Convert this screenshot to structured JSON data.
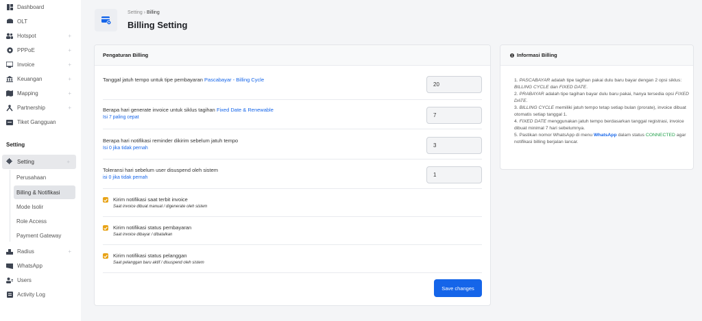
{
  "sidebar": {
    "items": [
      {
        "label": "Dashboard",
        "icon": "dashboard-icon",
        "plus": false
      },
      {
        "label": "OLT",
        "icon": "olt-icon",
        "plus": false
      },
      {
        "label": "Hotspot",
        "icon": "hotspot-icon",
        "plus": true
      },
      {
        "label": "PPPoE",
        "icon": "pppoe-icon",
        "plus": true
      },
      {
        "label": "Invoice",
        "icon": "invoice-icon",
        "plus": true
      },
      {
        "label": "Keuangan",
        "icon": "bank-icon",
        "plus": true
      },
      {
        "label": "Mapping",
        "icon": "map-icon",
        "plus": true
      },
      {
        "label": "Partnership",
        "icon": "partnership-icon",
        "plus": true
      },
      {
        "label": "Tiket Gangguan",
        "icon": "ticket-icon",
        "plus": false
      }
    ],
    "section_title": "Setting",
    "setting": {
      "label": "Setting",
      "icon": "gear-icon"
    },
    "sub_items": [
      "Perusahaan",
      "Billing & Notifikasi",
      "Mode Isolir",
      "Role Access",
      "Payment Gateway"
    ],
    "bottom_items": [
      {
        "label": "Radius",
        "icon": "radius-icon",
        "plus": true
      },
      {
        "label": "WhatsApp",
        "icon": "whatsapp-icon",
        "plus": false
      },
      {
        "label": "Users",
        "icon": "users-icon",
        "plus": false
      },
      {
        "label": "Activity Log",
        "icon": "log-icon",
        "plus": false
      }
    ],
    "plus_glyph": "+"
  },
  "header": {
    "crumb_parent": "Setting",
    "crumb_sep": "›",
    "crumb_current": "Billing",
    "title": "Billing Setting"
  },
  "billing": {
    "title": "Pengaturan Billing",
    "rows": [
      {
        "label": "Tanggal jatuh tempo untuk tipe pembayaran ",
        "link": "Pascabayar - Billing Cycle",
        "hint": "",
        "value": "20"
      },
      {
        "label": "Berapa hari generate invoice untuk siklus tagihan ",
        "link": "Fixed Date & Renewable",
        "hint": "Isi 7 paling cepat",
        "value": "7"
      },
      {
        "label": "Berapa hari notifikasi reminder dikirim sebelum jatuh tempo",
        "link": "",
        "hint": "Isi 0 jika tidak pernah",
        "value": "3"
      },
      {
        "label": "Toleransi hari sebelum user disuspend oleh sistem",
        "link": "",
        "hint": "isi 0 jika tidak pernah",
        "value": "1"
      }
    ],
    "checks": [
      {
        "label": "Kirim notifikasi saat terbit invoice",
        "desc": "Saat invoice dibuat manual / digenerate oleh sistem",
        "checked": true
      },
      {
        "label": "Kirim notifikasi status pembayaran",
        "desc": "Saat invoice dibayar / dibatalkan",
        "checked": true
      },
      {
        "label": "Kirim notifikasi status pelanggan",
        "desc": "Saat pelanggan baru aktif / disuspend oleh sistem",
        "checked": true
      }
    ],
    "save_label": "Save changes"
  },
  "info": {
    "title": "Informasi Billing",
    "i1": {
      "n": "1. ",
      "em": "PASCABAYAR",
      "t1": " adalah tipe tagihan pakai dulu baru bayar dengan 2 opsi siklus: ",
      "em2": "BILLING CYCLE",
      "t2": " dan ",
      "em3": "FIXED DATE",
      "t3": "."
    },
    "i2": {
      "n": "2. ",
      "em": "PRABAYAR",
      "t1": " adalah tipe tagihan bayar dulu baru pakai, hanya tersedia opsi ",
      "em2": "FIXED DATE",
      "t2": "."
    },
    "i3": {
      "n": "3. ",
      "em": "BILLING CYCLE",
      "t1": " memiliki jatuh tempo tetap setiap bulan (prorate), invoice dibuat otomatis setiap tanggal 1."
    },
    "i4": {
      "n": "4. ",
      "em": "FIXED DATE",
      "t1": " menggunakan jatuh tempo berdasarkan tanggal registrasi, invoice dibuat minimal 7 hari sebelumnya."
    },
    "i5": {
      "n": "5. ",
      "t1": "Pastikan nomor WhatsApp di menu ",
      "wa": "WhatsApp",
      "t2": " dalam status ",
      "conn": "CONNECTED",
      "t3": " agar notifikasi billing berjalan lancar."
    }
  },
  "colors": {
    "accent": "#1565e9",
    "check": "#e8a317",
    "connected": "#22a04b"
  }
}
